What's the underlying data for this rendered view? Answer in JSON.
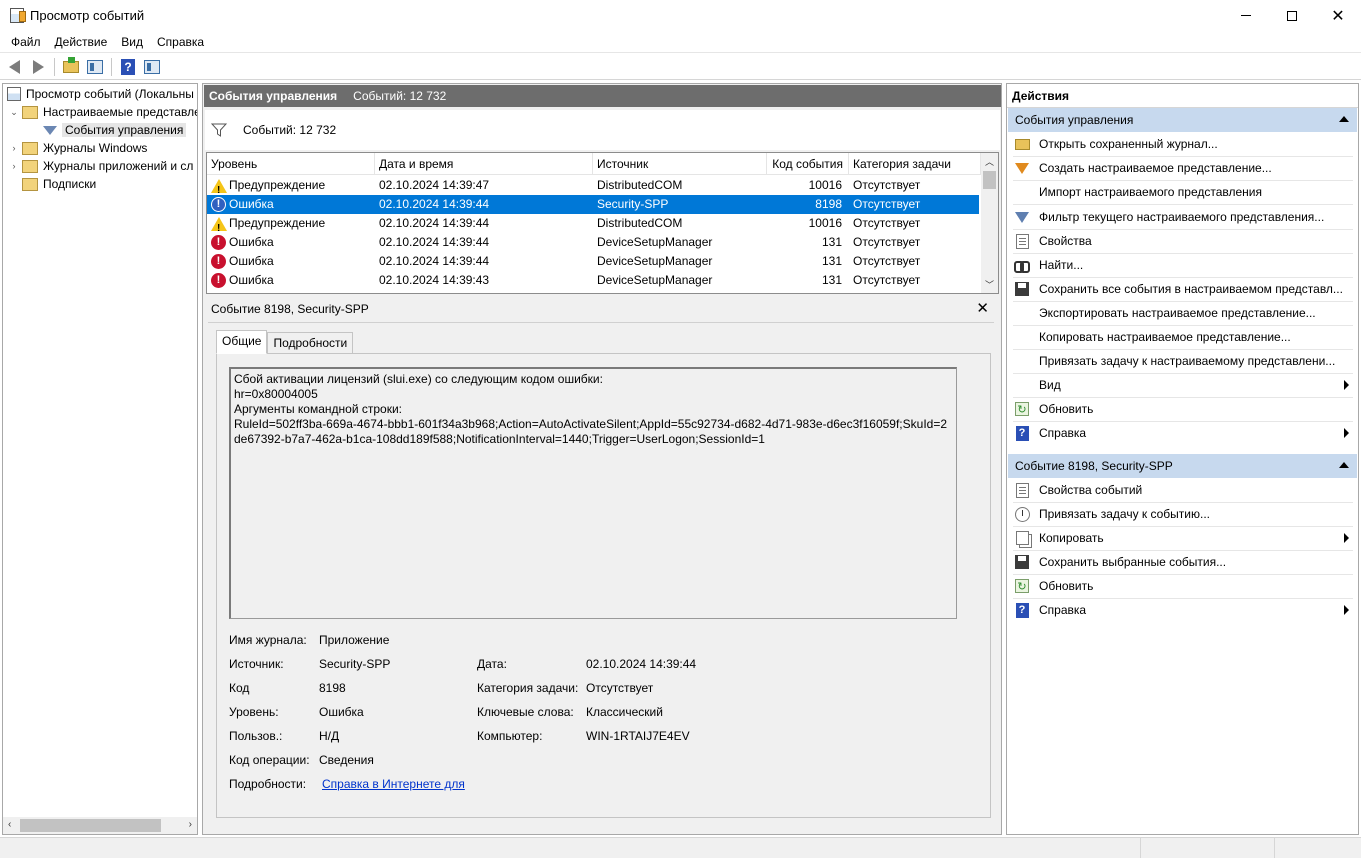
{
  "window": {
    "title": "Просмотр событий",
    "minimize_icon": "minimize-icon",
    "maximize_icon": "maximize-icon",
    "close_glyph": "✕"
  },
  "menu": [
    "Файл",
    "Действие",
    "Вид",
    "Справка"
  ],
  "tree": {
    "items": [
      {
        "label": "Просмотр событий (Локальны",
        "icon": "event-viewer-icon",
        "level": 0
      },
      {
        "label": "Настраиваемые представле",
        "icon": "folder-icon",
        "level": 1,
        "expanded": true
      },
      {
        "label": "События управления",
        "icon": "filter-icon",
        "level": 2,
        "selected": true
      },
      {
        "label": "Журналы Windows",
        "icon": "folder-icon",
        "level": 1
      },
      {
        "label": "Журналы приложений и сл",
        "icon": "folder-icon",
        "level": 1
      },
      {
        "label": "Подписки",
        "icon": "folder-icon",
        "level": 1
      }
    ]
  },
  "center": {
    "header_title": "События управления",
    "header_count": "Событий: 12 732",
    "filter_text": "Событий: 12 732",
    "columns": [
      "Уровень",
      "Дата и время",
      "Источник",
      "Код события",
      "Категория задачи"
    ],
    "rows": [
      {
        "level": "Предупреждение",
        "type": "warning",
        "date": "02.10.2024 14:39:47",
        "source": "DistributedCOM",
        "id": "10016",
        "category": "Отсутствует"
      },
      {
        "level": "Ошибка",
        "type": "error",
        "date": "02.10.2024 14:39:44",
        "source": "Security-SPP",
        "id": "8198",
        "category": "Отсутствует",
        "selected": true
      },
      {
        "level": "Предупреждение",
        "type": "warning",
        "date": "02.10.2024 14:39:44",
        "source": "DistributedCOM",
        "id": "10016",
        "category": "Отсутствует"
      },
      {
        "level": "Ошибка",
        "type": "error",
        "date": "02.10.2024 14:39:44",
        "source": "DeviceSetupManager",
        "id": "131",
        "category": "Отсутствует"
      },
      {
        "level": "Ошибка",
        "type": "error",
        "date": "02.10.2024 14:39:44",
        "source": "DeviceSetupManager",
        "id": "131",
        "category": "Отсутствует"
      },
      {
        "level": "Ошибка",
        "type": "error",
        "date": "02.10.2024 14:39:43",
        "source": "DeviceSetupManager",
        "id": "131",
        "category": "Отсутствует"
      }
    ]
  },
  "detail": {
    "title": "Событие 8198, Security-SPP",
    "close_glyph": "✕",
    "tabs": [
      "Общие",
      "Подробности"
    ],
    "message": "Сбой активации лицензий (slui.exe) со следующим кодом ошибки:\nhr=0x80004005\nАргументы командной строки:\nRuleId=502ff3ba-669a-4674-bbb1-601f34a3b968;Action=AutoActivateSilent;AppId=55c92734-d682-4d71-983e-d6ec3f16059f;SkuId=2de67392-b7a7-462a-b1ca-108dd189f588;NotificationInterval=1440;Trigger=UserLogon;SessionId=1",
    "fields": {
      "log_name_label": "Имя журнала:",
      "log_name": "Приложение",
      "source_label": "Источник:",
      "source": "Security-SPP",
      "date_label": "Дата:",
      "date": "02.10.2024 14:39:44",
      "code_label": "Код",
      "code": "8198",
      "category_label": "Категория задачи:",
      "category": "Отсутствует",
      "level_label": "Уровень:",
      "level": "Ошибка",
      "keywords_label": "Ключевые слова:",
      "keywords": "Классический",
      "user_label": "Пользов.:",
      "user": "Н/Д",
      "computer_label": "Компьютер:",
      "computer": "WIN-1RTAIJ7E4EV",
      "opcode_label": "Код операции:",
      "opcode": "Сведения",
      "more_label": "Подробности:",
      "more_link": "Справка в Интернете для "
    }
  },
  "actions": {
    "header": "Действия",
    "section1": {
      "title": "События управления",
      "items": [
        {
          "label": "Открыть сохраненный журнал...",
          "icon": "open-log-icon"
        },
        {
          "label": "Создать настраиваемое представление...",
          "icon": "create-view-icon"
        },
        {
          "label": "Импорт настраиваемого представления",
          "icon": ""
        },
        {
          "label": "Фильтр текущего настраиваемого представления...",
          "icon": "filter-icon"
        },
        {
          "label": "Свойства",
          "icon": "properties-icon"
        },
        {
          "label": "Найти...",
          "icon": "find-icon"
        },
        {
          "label": "Сохранить все события в настраиваемом представл...",
          "icon": "save-icon"
        },
        {
          "label": "Экспортировать настраиваемое представление...",
          "icon": ""
        },
        {
          "label": "Копировать настраиваемое представление...",
          "icon": ""
        },
        {
          "label": "Привязать задачу к настраиваемому представлени...",
          "icon": ""
        },
        {
          "label": "Вид",
          "icon": "",
          "submenu": true
        },
        {
          "label": "Обновить",
          "icon": "refresh-icon"
        },
        {
          "label": "Справка",
          "icon": "help-icon",
          "submenu": true
        }
      ]
    },
    "section2": {
      "title": "Событие 8198, Security-SPP",
      "items": [
        {
          "label": "Свойства событий",
          "icon": "event-properties-icon"
        },
        {
          "label": "Привязать задачу к событию...",
          "icon": "attach-task-icon"
        },
        {
          "label": "Копировать",
          "icon": "copy-icon",
          "submenu": true
        },
        {
          "label": "Сохранить выбранные события...",
          "icon": "save-icon"
        },
        {
          "label": "Обновить",
          "icon": "refresh-icon"
        },
        {
          "label": "Справка",
          "icon": "help-icon",
          "submenu": true
        }
      ]
    }
  },
  "colors": {
    "selection": "#0078d7",
    "center_header": "#6d6d6d",
    "section_header": "#c7d9ee",
    "error": "#c8102e",
    "warning": "#f5c518",
    "link": "#0033cc"
  }
}
